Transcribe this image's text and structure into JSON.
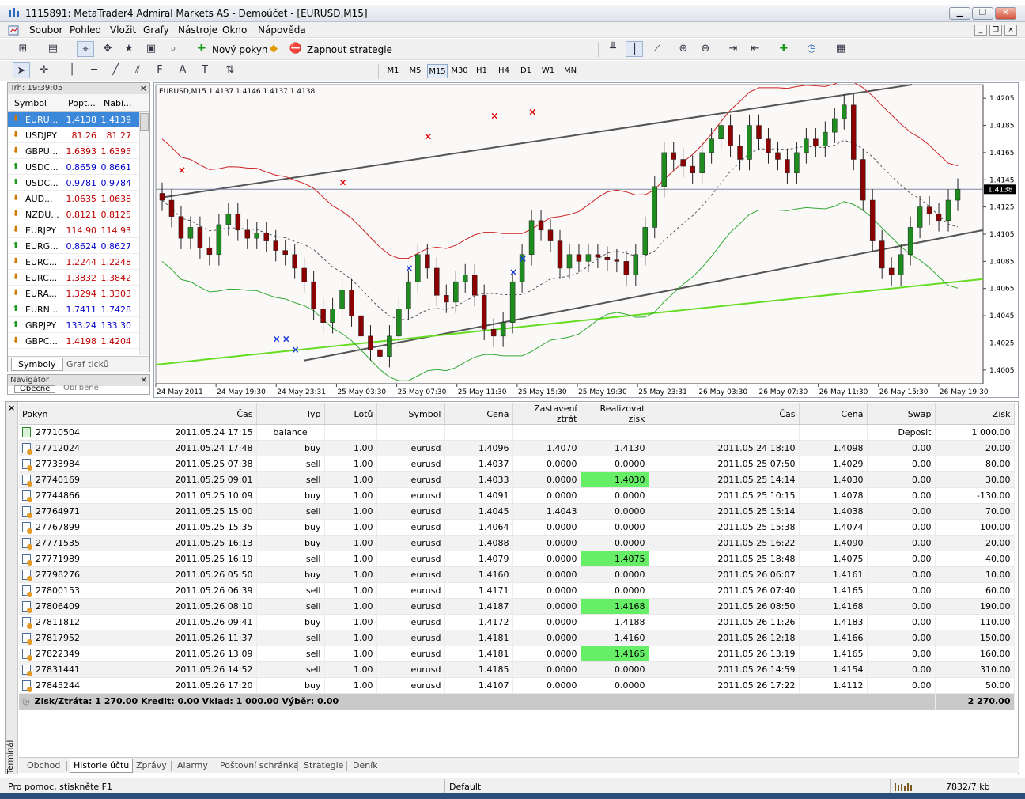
{
  "window": {
    "title": "1115891: MetaTrader4 Admiral Markets AS - Demoúčet - [EURUSD,M15]"
  },
  "menu": [
    "Soubor",
    "Pohled",
    "Vložit",
    "Grafy",
    "Nástroje",
    "Okno",
    "Nápověda"
  ],
  "toolbar": {
    "new_order": "Nový pokyn",
    "expert": "Zapnout strategie"
  },
  "timeframes": [
    "M1",
    "M5",
    "M15",
    "M30",
    "H1",
    "H4",
    "D1",
    "W1",
    "MN"
  ],
  "active_timeframe": "M15",
  "market_watch": {
    "header": "Trh: 19:39:05",
    "cols": [
      "Symbol",
      "Popt...",
      "Nabí..."
    ],
    "rows": [
      {
        "sym": "EURU...",
        "bid": "1.4138",
        "ask": "1.4139",
        "dir": "down",
        "color": "#000"
      },
      {
        "sym": "USDJPY",
        "bid": "81.26",
        "ask": "81.27",
        "dir": "down",
        "color": "#c00000"
      },
      {
        "sym": "GBPU...",
        "bid": "1.6393",
        "ask": "1.6395",
        "dir": "down",
        "color": "#c00000"
      },
      {
        "sym": "USDC...",
        "bid": "0.8659",
        "ask": "0.8661",
        "dir": "up",
        "color": "#0000cc"
      },
      {
        "sym": "USDC...",
        "bid": "0.9781",
        "ask": "0.9784",
        "dir": "up",
        "color": "#0000cc"
      },
      {
        "sym": "AUD...",
        "bid": "1.0635",
        "ask": "1.0638",
        "dir": "down",
        "color": "#c00000"
      },
      {
        "sym": "NZDU...",
        "bid": "0.8121",
        "ask": "0.8125",
        "dir": "down",
        "color": "#c00000"
      },
      {
        "sym": "EURJPY",
        "bid": "114.90",
        "ask": "114.93",
        "dir": "down",
        "color": "#c00000"
      },
      {
        "sym": "EURG...",
        "bid": "0.8624",
        "ask": "0.8627",
        "dir": "up",
        "color": "#0000cc"
      },
      {
        "sym": "EURC...",
        "bid": "1.2244",
        "ask": "1.2248",
        "dir": "down",
        "color": "#c00000"
      },
      {
        "sym": "EURC...",
        "bid": "1.3832",
        "ask": "1.3842",
        "dir": "down",
        "color": "#c00000"
      },
      {
        "sym": "EURA...",
        "bid": "1.3294",
        "ask": "1.3303",
        "dir": "down",
        "color": "#c00000"
      },
      {
        "sym": "EURN...",
        "bid": "1.7411",
        "ask": "1.7428",
        "dir": "up",
        "color": "#0000cc"
      },
      {
        "sym": "GBPJPY",
        "bid": "133.24",
        "ask": "133.30",
        "dir": "up",
        "color": "#0000cc"
      },
      {
        "sym": "GBPC...",
        "bid": "1.4198",
        "ask": "1.4204",
        "dir": "down",
        "color": "#c00000"
      }
    ],
    "tabs": [
      "Symboly",
      "Graf ticků"
    ]
  },
  "navigator": {
    "header": "Navigátor",
    "tabs": [
      "Obecné",
      "Oblíbené"
    ]
  },
  "chart_data": {
    "type": "candlestick",
    "title": "EURUSD,M15  1.4137 1.4146 1.4137 1.4138",
    "current_price": "1.4138",
    "y_ticks": [
      "1.4205",
      "1.4185",
      "1.4165",
      "1.4145",
      "1.4125",
      "1.4105",
      "1.4085",
      "1.4065",
      "1.4045",
      "1.4025",
      "1.4005"
    ],
    "ylim": [
      1.3995,
      1.4215
    ],
    "x_ticks": [
      "24 May 2011",
      "24 May 19:30",
      "24 May 23:31",
      "25 May 03:30",
      "25 May 07:30",
      "25 May 11:30",
      "25 May 15:30",
      "25 May 19:30",
      "25 May 23:31",
      "26 May 03:30",
      "26 May 07:30",
      "26 May 11:30",
      "26 May 15:30",
      "26 May 19:30"
    ],
    "closes": [
      1.413,
      1.4118,
      1.4102,
      1.411,
      1.4095,
      1.409,
      1.4112,
      1.412,
      1.4108,
      1.4102,
      1.4106,
      1.41,
      1.4093,
      1.409,
      1.408,
      1.407,
      1.405,
      1.404,
      1.405,
      1.4064,
      1.4045,
      1.403,
      1.402,
      1.4015,
      1.403,
      1.405,
      1.407,
      1.409,
      1.408,
      1.406,
      1.4055,
      1.407,
      1.4075,
      1.406,
      1.4035,
      1.403,
      1.404,
      1.407,
      1.409,
      1.4115,
      1.4108,
      1.41,
      1.408,
      1.409,
      1.4085,
      1.409,
      1.4088,
      1.4086,
      1.4085,
      1.4075,
      1.409,
      1.411,
      1.414,
      1.4165,
      1.416,
      1.4155,
      1.415,
      1.4165,
      1.4175,
      1.4185,
      1.417,
      1.416,
      1.4185,
      1.4175,
      1.4165,
      1.416,
      1.415,
      1.4165,
      1.4175,
      1.417,
      1.418,
      1.419,
      1.42,
      1.416,
      1.413,
      1.41,
      1.408,
      1.4075,
      1.409,
      1.411,
      1.4125,
      1.412,
      1.4115,
      1.413,
      1.4138
    ],
    "red_x": [
      [
        2,
        1.4152
      ],
      [
        19,
        1.4143
      ],
      [
        28,
        1.4177
      ],
      [
        35,
        1.4192
      ],
      [
        39,
        1.4195
      ]
    ],
    "blue_x": [
      [
        12,
        1.4028
      ],
      [
        13,
        1.4028
      ],
      [
        14,
        1.402
      ],
      [
        26,
        1.408
      ],
      [
        37,
        1.4077
      ],
      [
        38,
        1.4087
      ]
    ]
  },
  "terminal": {
    "side_label": "Terminál",
    "columns": [
      "Pokyn",
      "Čas",
      "Typ",
      "Lotů",
      "Symbol",
      "Cena",
      "Zastavení ztrát",
      "Realizovat zisk",
      "Čas",
      "Cena",
      "Swap",
      "Zisk"
    ],
    "rows": [
      {
        "id": "27710504",
        "t1": "2011.05.24 17:15",
        "typ": "balance",
        "lots": "",
        "sym": "",
        "p1": "",
        "sl": "",
        "tp": "",
        "t2": "",
        "p2": "",
        "swap": "Deposit",
        "zisk": "1 000.00",
        "hl": false,
        "bal": true
      },
      {
        "id": "27712024",
        "t1": "2011.05.24 17:48",
        "typ": "buy",
        "lots": "1.00",
        "sym": "eurusd",
        "p1": "1.4096",
        "sl": "1.4070",
        "tp": "1.4130",
        "t2": "2011.05.24 18:10",
        "p2": "1.4098",
        "swap": "0.00",
        "zisk": "20.00",
        "hl": false
      },
      {
        "id": "27733984",
        "t1": "2011.05.25 07:38",
        "typ": "sell",
        "lots": "1.00",
        "sym": "eurusd",
        "p1": "1.4037",
        "sl": "0.0000",
        "tp": "0.0000",
        "t2": "2011.05.25 07:50",
        "p2": "1.4029",
        "swap": "0.00",
        "zisk": "80.00",
        "hl": false
      },
      {
        "id": "27740169",
        "t1": "2011.05.25 09:01",
        "typ": "sell",
        "lots": "1.00",
        "sym": "eurusd",
        "p1": "1.4033",
        "sl": "0.0000",
        "tp": "1.4030",
        "t2": "2011.05.25 14:14",
        "p2": "1.4030",
        "swap": "0.00",
        "zisk": "30.00",
        "hl": true
      },
      {
        "id": "27744866",
        "t1": "2011.05.25 10:09",
        "typ": "buy",
        "lots": "1.00",
        "sym": "eurusd",
        "p1": "1.4091",
        "sl": "0.0000",
        "tp": "0.0000",
        "t2": "2011.05.25 10:15",
        "p2": "1.4078",
        "swap": "0.00",
        "zisk": "-130.00",
        "hl": false
      },
      {
        "id": "27764971",
        "t1": "2011.05.25 15:00",
        "typ": "sell",
        "lots": "1.00",
        "sym": "eurusd",
        "p1": "1.4045",
        "sl": "1.4043",
        "tp": "0.0000",
        "t2": "2011.05.25 15:14",
        "p2": "1.4038",
        "swap": "0.00",
        "zisk": "70.00",
        "hl": false
      },
      {
        "id": "27767899",
        "t1": "2011.05.25 15:35",
        "typ": "buy",
        "lots": "1.00",
        "sym": "eurusd",
        "p1": "1.4064",
        "sl": "0.0000",
        "tp": "0.0000",
        "t2": "2011.05.25 15:38",
        "p2": "1.4074",
        "swap": "0.00",
        "zisk": "100.00",
        "hl": false
      },
      {
        "id": "27771535",
        "t1": "2011.05.25 16:13",
        "typ": "buy",
        "lots": "1.00",
        "sym": "eurusd",
        "p1": "1.4088",
        "sl": "0.0000",
        "tp": "0.0000",
        "t2": "2011.05.25 16:22",
        "p2": "1.4090",
        "swap": "0.00",
        "zisk": "20.00",
        "hl": false
      },
      {
        "id": "27771989",
        "t1": "2011.05.25 16:19",
        "typ": "sell",
        "lots": "1.00",
        "sym": "eurusd",
        "p1": "1.4079",
        "sl": "0.0000",
        "tp": "1.4075",
        "t2": "2011.05.25 18:48",
        "p2": "1.4075",
        "swap": "0.00",
        "zisk": "40.00",
        "hl": true
      },
      {
        "id": "27798276",
        "t1": "2011.05.26 05:50",
        "typ": "buy",
        "lots": "1.00",
        "sym": "eurusd",
        "p1": "1.4160",
        "sl": "0.0000",
        "tp": "0.0000",
        "t2": "2011.05.26 06:07",
        "p2": "1.4161",
        "swap": "0.00",
        "zisk": "10.00",
        "hl": false
      },
      {
        "id": "27800153",
        "t1": "2011.05.26 06:39",
        "typ": "sell",
        "lots": "1.00",
        "sym": "eurusd",
        "p1": "1.4171",
        "sl": "0.0000",
        "tp": "0.0000",
        "t2": "2011.05.26 07:40",
        "p2": "1.4165",
        "swap": "0.00",
        "zisk": "60.00",
        "hl": false
      },
      {
        "id": "27806409",
        "t1": "2011.05.26 08:10",
        "typ": "sell",
        "lots": "1.00",
        "sym": "eurusd",
        "p1": "1.4187",
        "sl": "0.0000",
        "tp": "1.4168",
        "t2": "2011.05.26 08:50",
        "p2": "1.4168",
        "swap": "0.00",
        "zisk": "190.00",
        "hl": true
      },
      {
        "id": "27811812",
        "t1": "2011.05.26 09:41",
        "typ": "buy",
        "lots": "1.00",
        "sym": "eurusd",
        "p1": "1.4172",
        "sl": "0.0000",
        "tp": "1.4188",
        "t2": "2011.05.26 11:26",
        "p2": "1.4183",
        "swap": "0.00",
        "zisk": "110.00",
        "hl": false
      },
      {
        "id": "27817952",
        "t1": "2011.05.26 11:37",
        "typ": "sell",
        "lots": "1.00",
        "sym": "eurusd",
        "p1": "1.4181",
        "sl": "0.0000",
        "tp": "1.4160",
        "t2": "2011.05.26 12:18",
        "p2": "1.4166",
        "swap": "0.00",
        "zisk": "150.00",
        "hl": false
      },
      {
        "id": "27822349",
        "t1": "2011.05.26 13:09",
        "typ": "sell",
        "lots": "1.00",
        "sym": "eurusd",
        "p1": "1.4181",
        "sl": "0.0000",
        "tp": "1.4165",
        "t2": "2011.05.26 13:19",
        "p2": "1.4165",
        "swap": "0.00",
        "zisk": "160.00",
        "hl": true
      },
      {
        "id": "27831441",
        "t1": "2011.05.26 14:52",
        "typ": "sell",
        "lots": "1.00",
        "sym": "eurusd",
        "p1": "1.4185",
        "sl": "0.0000",
        "tp": "0.0000",
        "t2": "2011.05.26 14:59",
        "p2": "1.4154",
        "swap": "0.00",
        "zisk": "310.00",
        "hl": false
      },
      {
        "id": "27845244",
        "t1": "2011.05.26 17:20",
        "typ": "buy",
        "lots": "1.00",
        "sym": "eurusd",
        "p1": "1.4107",
        "sl": "0.0000",
        "tp": "0.0000",
        "t2": "2011.05.26 17:22",
        "p2": "1.4112",
        "swap": "0.00",
        "zisk": "50.00",
        "hl": false
      }
    ],
    "summary": {
      "text": "Zisk/Ztráta: 1 270.00  Kredit: 0.00  Vklad: 1 000.00  Výběr: 0.00",
      "total": "2 270.00"
    },
    "tabs": [
      "Obchod",
      "Historie účtu",
      "Zprávy",
      "Alarmy",
      "Poštovní schránka",
      "Strategie",
      "Deník"
    ],
    "active_tab": "Historie účtu"
  },
  "status": {
    "help": "Pro pomoc, stiskněte F1",
    "profile": "Default",
    "traffic": "7832/7 kb"
  },
  "colors": {
    "hl_green": "#66ee66",
    "bull": "#1e8c1e",
    "bear": "#8b0000",
    "sel_blue": "#3b87d9"
  }
}
